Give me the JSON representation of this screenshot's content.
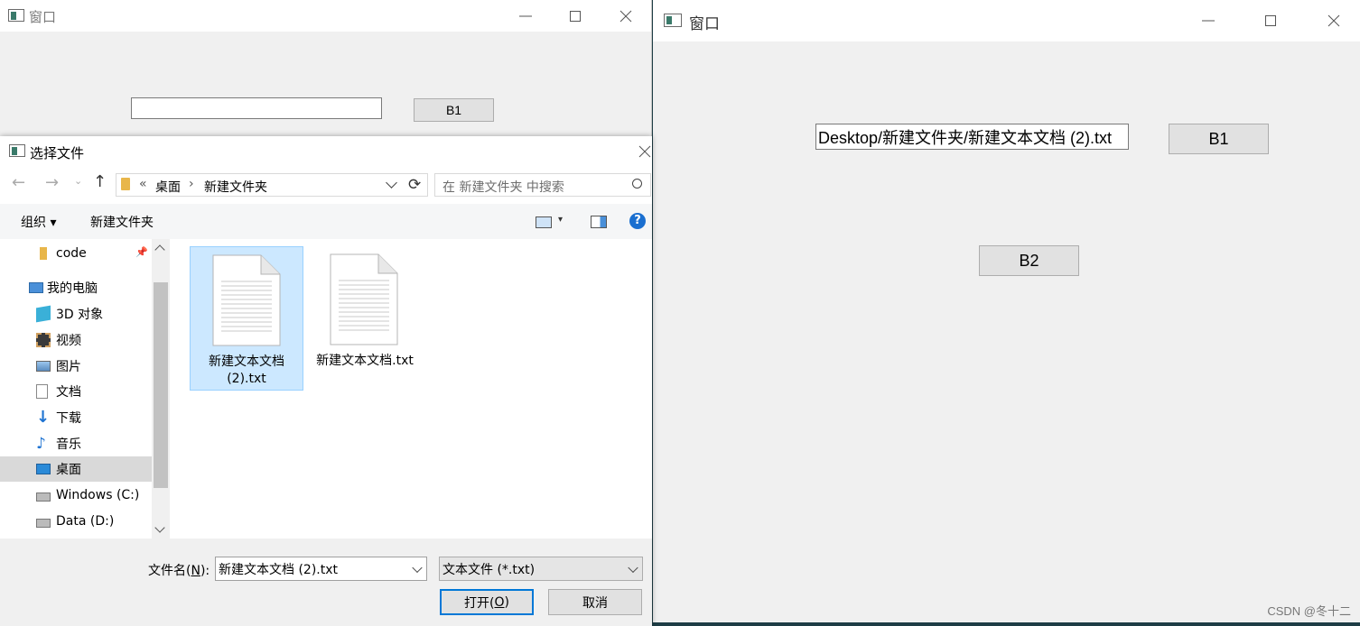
{
  "left_window": {
    "title": "窗口",
    "input_value": "",
    "b1_label": "B1"
  },
  "right_window": {
    "title": "窗口",
    "path_value": "Desktop/新建文件夹/新建文本文档 (2).txt",
    "b1_label": "B1",
    "b2_label": "B2",
    "watermark": "CSDN @冬十二"
  },
  "dialog": {
    "title": "选择文件",
    "breadcrumb": {
      "overflow": "«",
      "segments": [
        "桌面",
        "新建文件夹"
      ],
      "separator": "›"
    },
    "search_placeholder": "在 新建文件夹 中搜索",
    "toolbar": {
      "organize_label": "组织 ▾",
      "new_folder_label": "新建文件夹",
      "help_label": "?"
    },
    "nav_items": [
      {
        "label": "code",
        "icon": "folder-icon"
      },
      {
        "label": "我的电脑",
        "icon": "computer-icon"
      },
      {
        "label": "3D 对象",
        "icon": "cube-icon"
      },
      {
        "label": "视频",
        "icon": "video-icon"
      },
      {
        "label": "图片",
        "icon": "picture-icon"
      },
      {
        "label": "文档",
        "icon": "document-icon"
      },
      {
        "label": "下载",
        "icon": "download-icon"
      },
      {
        "label": "音乐",
        "icon": "music-icon"
      },
      {
        "label": "桌面",
        "icon": "desktop-icon",
        "selected": true
      },
      {
        "label": "Windows (C:)",
        "icon": "drive-icon"
      },
      {
        "label": "Data (D:)",
        "icon": "drive-icon"
      }
    ],
    "files": [
      {
        "name_line1": "新建文本文档",
        "name_line2": "(2).txt",
        "selected": true
      },
      {
        "name_line1": "新建文本文档.txt",
        "name_line2": "",
        "selected": false
      }
    ],
    "filename_label_prefix": "文件名(",
    "filename_label_key": "N",
    "filename_label_suffix": "):",
    "filename_value": "新建文本文档 (2).txt",
    "filetype_value": "文本文件 (*.txt)",
    "open_label_prefix": "打开(",
    "open_label_key": "O",
    "open_label_suffix": ")",
    "cancel_label": "取消"
  },
  "colors": {
    "selection_bg": "#cce8ff",
    "selection_border": "#99d1ff",
    "accent": "#0078d7",
    "window_bg": "#f0f0f0"
  }
}
